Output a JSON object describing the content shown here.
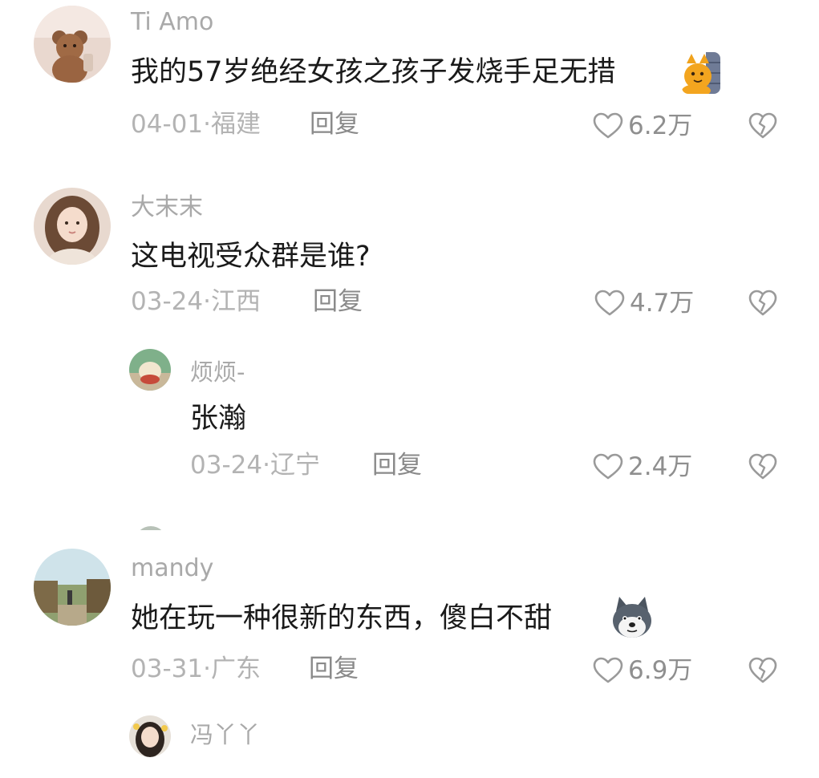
{
  "comments": [
    {
      "username": "Ti Amo",
      "text": "我的57岁绝经女孩之孩子发烧手足无措",
      "emoji": "cat-emoji",
      "date": "04-01",
      "separator": "·",
      "location": "福建",
      "reply_label": "回复",
      "likes": "6.2万",
      "avatar": "teddy-bear-avatar"
    },
    {
      "username": "大末末",
      "text": "这电视受众群是谁?",
      "date": "03-24",
      "separator": "·",
      "location": "江西",
      "reply_label": "回复",
      "likes": "4.7万",
      "avatar": "girl-avatar",
      "replies": [
        {
          "username": "烦烦-",
          "text": "张瀚",
          "date": "03-24",
          "separator": "·",
          "location": "辽宁",
          "reply_label": "回复",
          "likes": "2.4万",
          "avatar": "food-avatar"
        }
      ]
    },
    {
      "username": "mandy",
      "text": "她在玩一种很新的东西，傻白不甜",
      "emoji": "husky-dog-emoji",
      "date": "03-31",
      "separator": "·",
      "location": "广东",
      "reply_label": "回复",
      "likes": "6.9万",
      "avatar": "landscape-avatar",
      "replies": [
        {
          "username": "冯丫丫",
          "avatar": "girl-avatar-2"
        }
      ]
    }
  ],
  "colors": {
    "username": "#a9a9a9",
    "text": "#1a1a1a",
    "meta": "#b3b3b3",
    "reply": "#8a8a8a",
    "like_icon": "#9a9a9a"
  }
}
